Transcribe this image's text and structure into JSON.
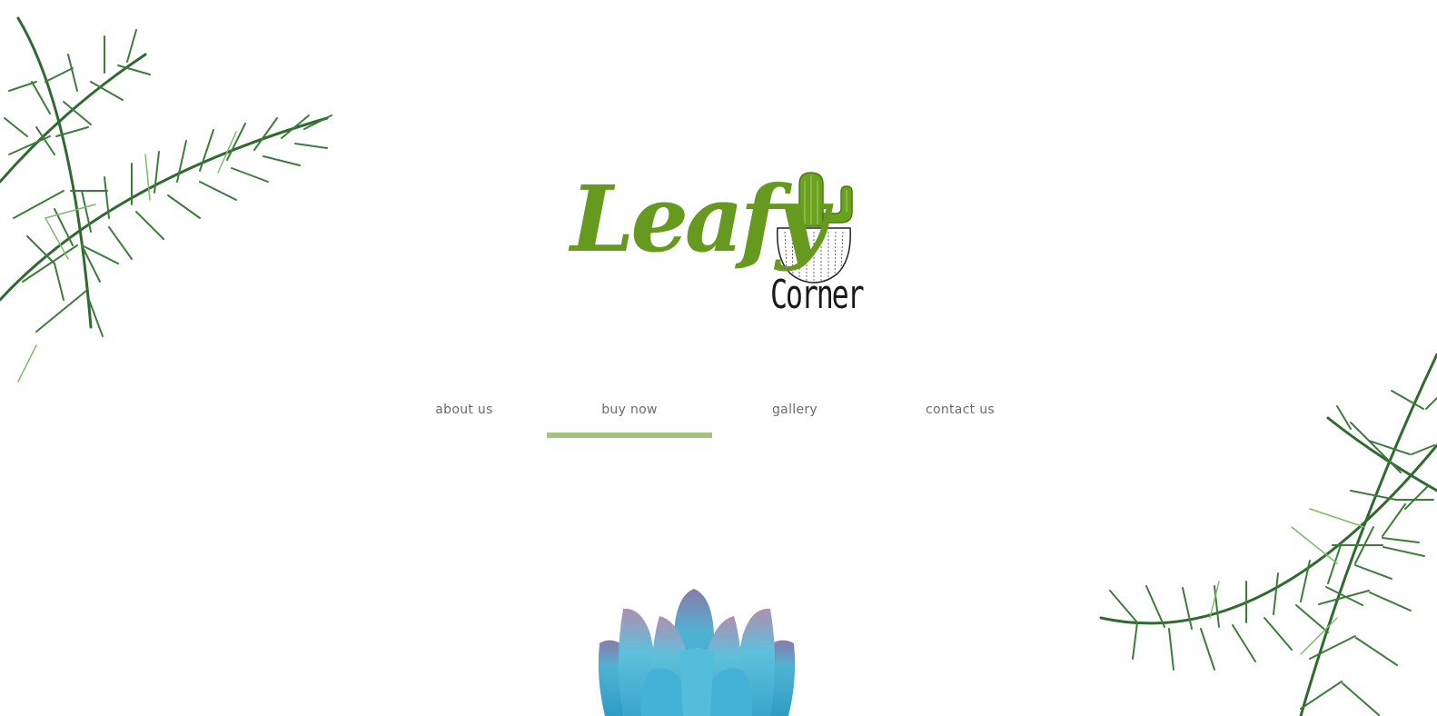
{
  "brand": {
    "name_script": "Leafy",
    "name_sub": "Corner"
  },
  "nav": {
    "items": [
      {
        "label": "about us",
        "active": false
      },
      {
        "label": "buy now",
        "active": true
      },
      {
        "label": "gallery",
        "active": false
      },
      {
        "label": "contact us",
        "active": false
      }
    ]
  },
  "colors": {
    "brand_green": "#659a1e",
    "active_underline": "#a4c47e",
    "nav_text": "#6b6b6b",
    "background": "#ffffff"
  },
  "icons": {
    "logo_cactus": "cactus-pot-icon",
    "decor_top_left": "palm-frond-icon",
    "decor_bottom_right": "palm-frond-icon",
    "hero_plant": "succulent-icon"
  }
}
